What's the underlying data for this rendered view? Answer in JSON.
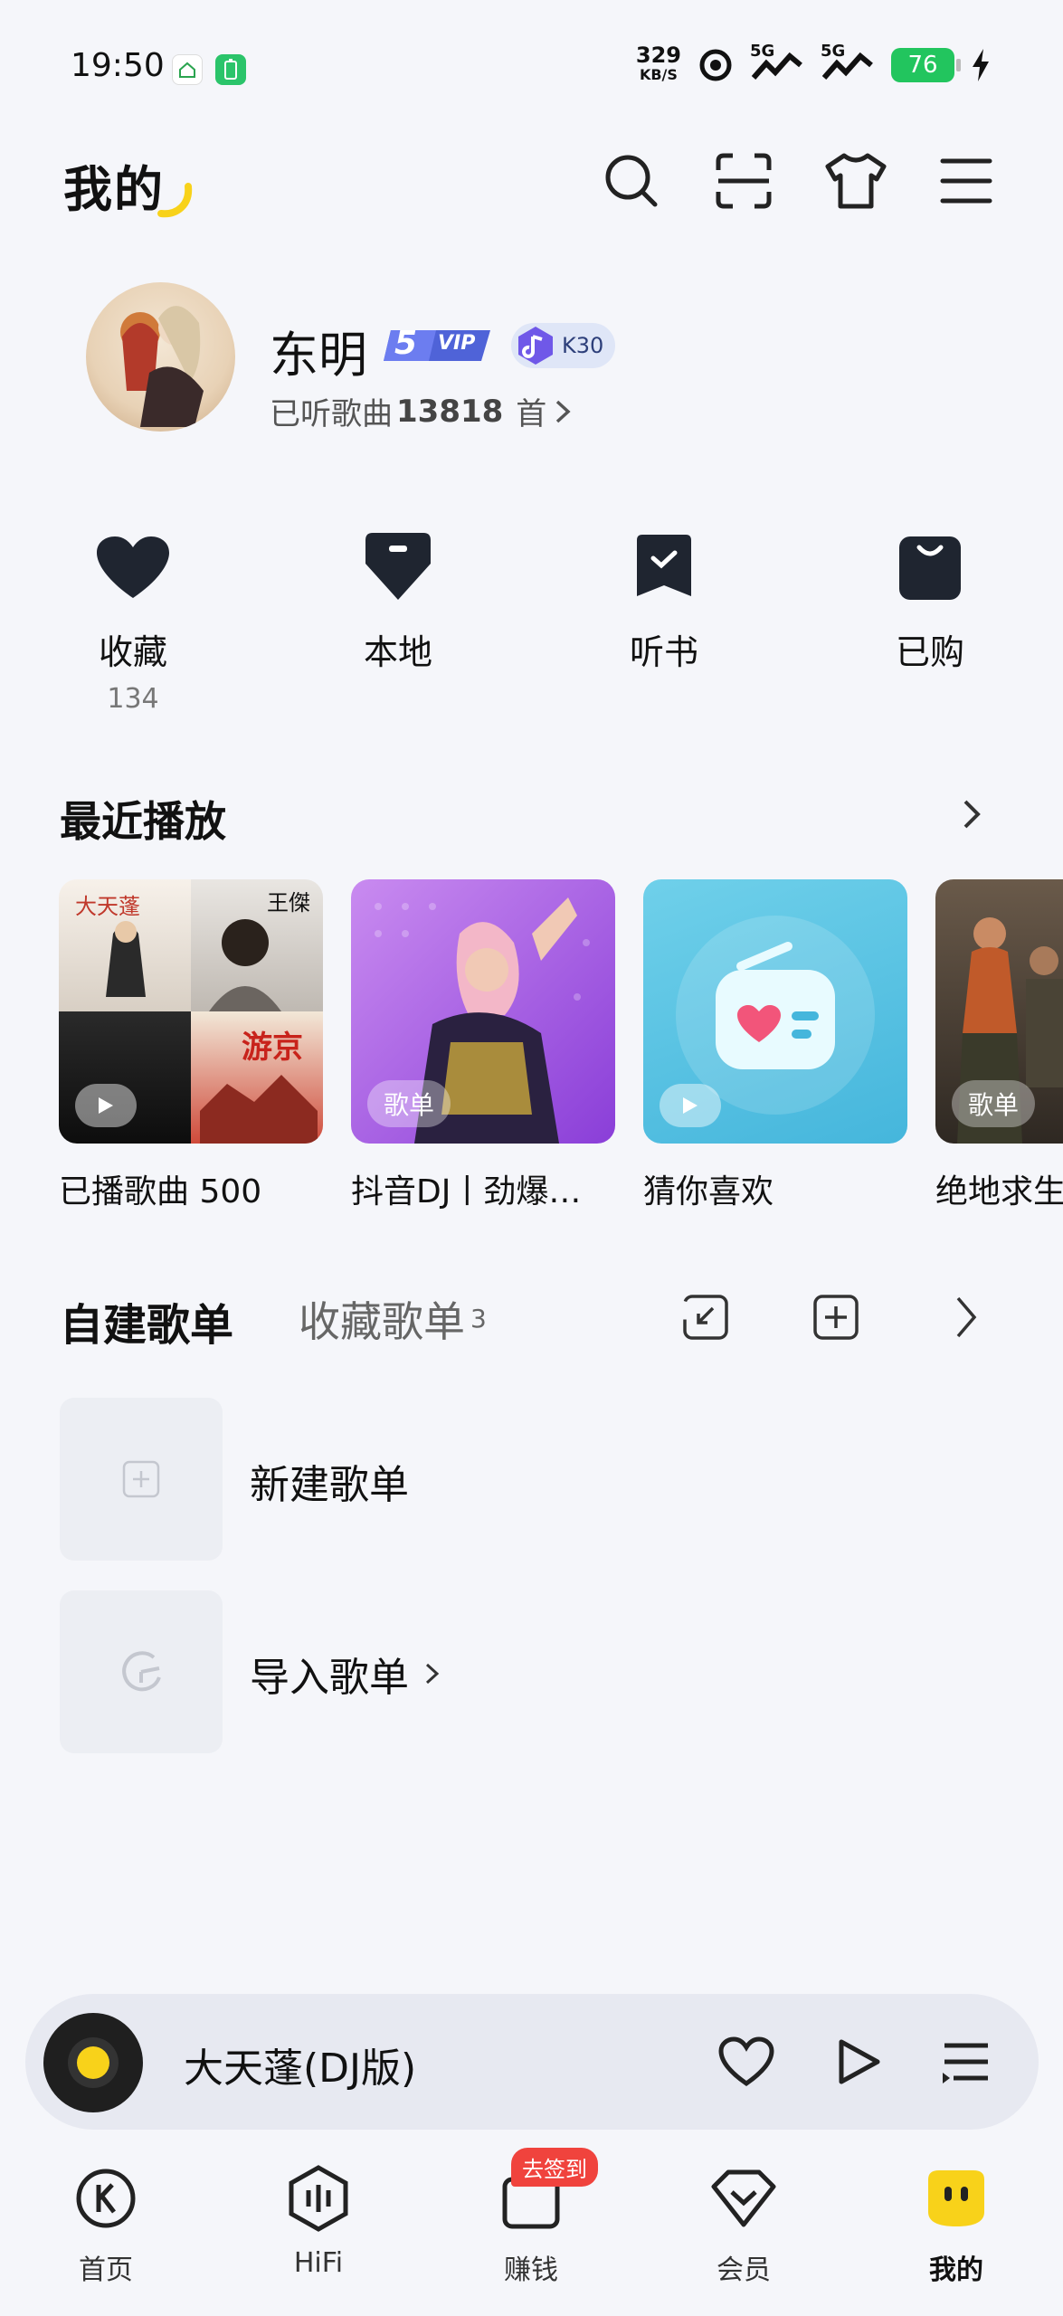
{
  "status_bar": {
    "time": "19:50",
    "net_speed": "329",
    "net_unit": "KB/S",
    "signal_1": "5G",
    "signal_2": "5G",
    "battery": "76"
  },
  "header": {
    "title": "我的",
    "icons": [
      "search-icon",
      "scan-icon",
      "skin-icon",
      "menu-icon"
    ]
  },
  "profile": {
    "name": "东明",
    "vip_level": "5",
    "vip_text": "VIP",
    "k_badge": "K30",
    "listened_prefix": "已听歌曲",
    "listened_count": "13818",
    "listened_suffix": "首"
  },
  "quick_entries": [
    {
      "label": "收藏",
      "count": "134",
      "icon": "heart-icon"
    },
    {
      "label": "本地",
      "icon": "download-icon"
    },
    {
      "label": "听书",
      "icon": "book-icon"
    },
    {
      "label": "已购",
      "icon": "bag-icon"
    }
  ],
  "recent": {
    "title": "最近播放",
    "items": [
      {
        "label": "已播歌曲 500",
        "tag": ""
      },
      {
        "label": "抖音DJ丨劲爆…",
        "tag": "歌单"
      },
      {
        "label": "猜你喜欢",
        "tag": ""
      },
      {
        "label": "绝地求生",
        "tag": "歌单"
      }
    ],
    "collage_texts": [
      "大天蓬",
      "王傑",
      "游京"
    ]
  },
  "playlists": {
    "tab_own": "自建歌单",
    "tab_fav": "收藏歌单",
    "tab_fav_count": "3",
    "items": [
      {
        "label": "新建歌单"
      },
      {
        "label": "导入歌单"
      }
    ]
  },
  "player": {
    "song": "大天蓬(DJ版)"
  },
  "bottom_nav": [
    {
      "label": "首页",
      "icon": "home-k-icon"
    },
    {
      "label": "HiFi",
      "icon": "hifi-icon"
    },
    {
      "label": "赚钱",
      "icon": "earn-icon",
      "badge": "去签到"
    },
    {
      "label": "会员",
      "icon": "vip-heart-icon"
    },
    {
      "label": "我的",
      "icon": "mine-icon",
      "active": true
    }
  ],
  "colors": {
    "accent_yellow": "#f8d21a",
    "badge_red": "#f0433d",
    "background": "#f5f6fa"
  }
}
